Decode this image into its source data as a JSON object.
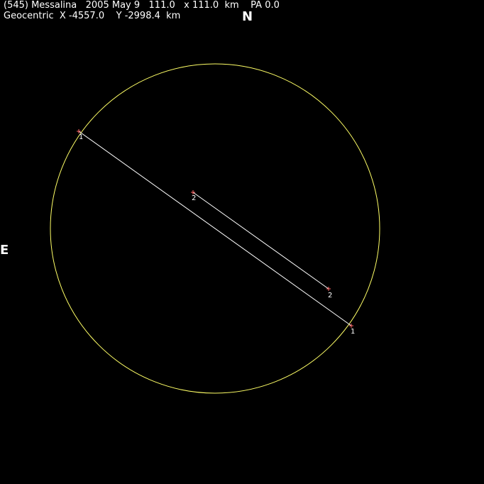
{
  "header": {
    "line1": "(545) Messalina   2005 May 9   111.0   x 111.0  km    PA 0.0",
    "line2": "Geocentric  X -4557.0    Y -2998.4  km"
  },
  "compass": {
    "north": "N",
    "east": "E"
  },
  "colors": {
    "background": "#000000",
    "ellipse": "#ffff66",
    "chord": "#ffffff",
    "endpoint_marker": "#ff6666",
    "text": "#ffffff"
  },
  "chords": [
    {
      "id": "1",
      "start_label": "1",
      "end_label": "1"
    },
    {
      "id": "2",
      "start_label": "2",
      "end_label": "2"
    }
  ]
}
